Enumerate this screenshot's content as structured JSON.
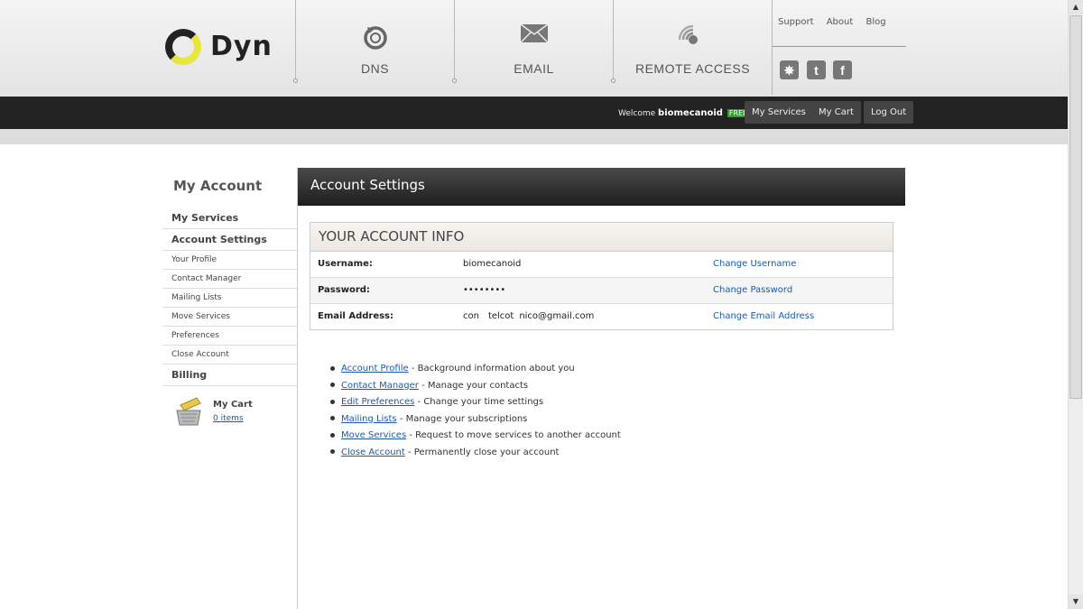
{
  "logo": {
    "text": "Dyn"
  },
  "nav": [
    {
      "label": "DNS",
      "icon": "refresh-icon"
    },
    {
      "label": "EMAIL",
      "icon": "envelope-icon"
    },
    {
      "label": "REMOTE ACCESS",
      "icon": "signal-icon"
    }
  ],
  "top_links": [
    "Support",
    "About",
    "Blog"
  ],
  "social": [
    {
      "name": "blog-icon",
      "glyph": "✵"
    },
    {
      "name": "twitter-icon",
      "glyph": "t"
    },
    {
      "name": "facebook-icon",
      "glyph": "f"
    }
  ],
  "userbar": {
    "welcome": "Welcome",
    "username": "biomecanoid",
    "plan_badge": "FREE",
    "buttons": [
      "My Services",
      "My Cart",
      "Log Out"
    ]
  },
  "sidebar": {
    "title": "My Account",
    "items": [
      {
        "label": "My Services",
        "size": "big"
      },
      {
        "label": "Account Settings",
        "size": "big"
      },
      {
        "label": "Your Profile",
        "size": "small"
      },
      {
        "label": "Contact Manager",
        "size": "small"
      },
      {
        "label": "Mailing Lists",
        "size": "small"
      },
      {
        "label": "Move Services",
        "size": "small"
      },
      {
        "label": "Preferences",
        "size": "small"
      },
      {
        "label": "Close Account",
        "size": "small"
      },
      {
        "label": "Billing",
        "size": "big"
      }
    ],
    "cart": {
      "label": "My Cart",
      "count": "0 items"
    }
  },
  "main": {
    "title": "Account Settings",
    "info_title": "YOUR ACCOUNT INFO",
    "rows": [
      {
        "key": "Username:",
        "value": "biomecanoid",
        "action": "Change Username"
      },
      {
        "key": "Password:",
        "value": "••••••••",
        "action": "Change Password"
      },
      {
        "key": "Email Address:",
        "value": "con     telcot   nico@gmail.com",
        "action": "Change Email Address"
      }
    ],
    "links": [
      {
        "link": "Account Profile",
        "desc": " - Background information about you"
      },
      {
        "link": "Contact Manager",
        "desc": " - Manage your contacts"
      },
      {
        "link": "Edit Preferences",
        "desc": " - Change your time settings"
      },
      {
        "link": "Mailing Lists",
        "desc": " - Manage your subscriptions"
      },
      {
        "link": "Move Services",
        "desc": " - Request to move services to another account"
      },
      {
        "link": "Close Account",
        "desc": " - Permanently close your account"
      }
    ]
  }
}
